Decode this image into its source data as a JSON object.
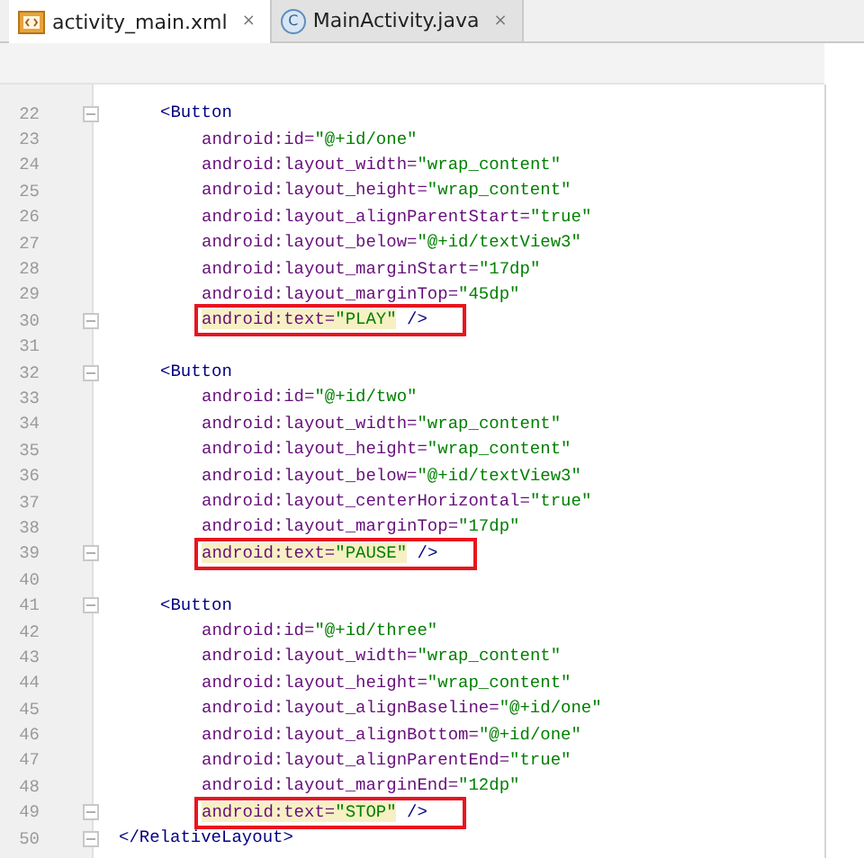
{
  "tabs": [
    {
      "label": "activity_main.xml",
      "kind": "xml",
      "selected": true,
      "close": "×"
    },
    {
      "label": "MainActivity.java",
      "kind": "class",
      "selected": false,
      "close": "×",
      "icon_text": "C"
    }
  ],
  "editor": {
    "lines": [
      {
        "number": "22",
        "fold": true,
        "highlighted": false,
        "tokens": [
          {
            "kind": "tag",
            "t": "<Button"
          }
        ]
      },
      {
        "number": "23",
        "fold": false,
        "highlighted": false,
        "tokens": [
          {
            "kind": "attr",
            "t": "android:id="
          },
          {
            "kind": "value",
            "t": "\"@+id/one\""
          }
        ]
      },
      {
        "number": "24",
        "fold": false,
        "highlighted": false,
        "tokens": [
          {
            "kind": "attr",
            "t": "android:layout_width="
          },
          {
            "kind": "value",
            "t": "\"wrap_content\""
          }
        ]
      },
      {
        "number": "25",
        "fold": false,
        "highlighted": false,
        "tokens": [
          {
            "kind": "attr",
            "t": "android:layout_height="
          },
          {
            "kind": "value",
            "t": "\"wrap_content\""
          }
        ]
      },
      {
        "number": "26",
        "fold": false,
        "highlighted": false,
        "tokens": [
          {
            "kind": "attr",
            "t": "android:layout_alignParentStart="
          },
          {
            "kind": "value",
            "t": "\"true\""
          }
        ]
      },
      {
        "number": "27",
        "fold": false,
        "highlighted": false,
        "tokens": [
          {
            "kind": "attr",
            "t": "android:layout_below="
          },
          {
            "kind": "value",
            "t": "\"@+id/textView3\""
          }
        ]
      },
      {
        "number": "28",
        "fold": false,
        "highlighted": false,
        "tokens": [
          {
            "kind": "attr",
            "t": "android:layout_marginStart="
          },
          {
            "kind": "value",
            "t": "\"17dp\""
          }
        ]
      },
      {
        "number": "29",
        "fold": false,
        "highlighted": false,
        "tokens": [
          {
            "kind": "attr",
            "t": "android:layout_marginTop="
          },
          {
            "kind": "value",
            "t": "\"45dp\""
          }
        ]
      },
      {
        "number": "30",
        "fold": true,
        "highlighted": true,
        "tokens": [
          {
            "kind": "attr",
            "t": "android:text="
          },
          {
            "kind": "value",
            "t": "\"PLAY\""
          },
          {
            "kind": "punct",
            "t": " />"
          }
        ]
      },
      {
        "number": "31",
        "fold": false,
        "highlighted": false
      },
      {
        "number": "32",
        "fold": true,
        "highlighted": false,
        "tokens": [
          {
            "kind": "tag",
            "t": "<Button"
          }
        ]
      },
      {
        "number": "33",
        "fold": false,
        "highlighted": false,
        "tokens": [
          {
            "kind": "attr",
            "t": "android:id="
          },
          {
            "kind": "value",
            "t": "\"@+id/two\""
          }
        ]
      },
      {
        "number": "34",
        "fold": false,
        "highlighted": false,
        "tokens": [
          {
            "kind": "attr",
            "t": "android:layout_width="
          },
          {
            "kind": "value",
            "t": "\"wrap_content\""
          }
        ]
      },
      {
        "number": "35",
        "fold": false,
        "highlighted": false,
        "tokens": [
          {
            "kind": "attr",
            "t": "android:layout_height="
          },
          {
            "kind": "value",
            "t": "\"wrap_content\""
          }
        ]
      },
      {
        "number": "36",
        "fold": false,
        "highlighted": false,
        "tokens": [
          {
            "kind": "attr",
            "t": "android:layout_below="
          },
          {
            "kind": "value",
            "t": "\"@+id/textView3\""
          }
        ]
      },
      {
        "number": "37",
        "fold": false,
        "highlighted": false,
        "tokens": [
          {
            "kind": "attr",
            "t": "android:layout_centerHorizontal="
          },
          {
            "kind": "value",
            "t": "\"true\""
          }
        ]
      },
      {
        "number": "38",
        "fold": false,
        "highlighted": false,
        "tokens": [
          {
            "kind": "attr",
            "t": "android:layout_marginTop="
          },
          {
            "kind": "value",
            "t": "\"17dp\""
          }
        ]
      },
      {
        "number": "39",
        "fold": true,
        "highlighted": true,
        "tokens": [
          {
            "kind": "attr",
            "t": "android:text="
          },
          {
            "kind": "value",
            "t": "\"PAUSE\""
          },
          {
            "kind": "punct",
            "t": " />"
          }
        ]
      },
      {
        "number": "40",
        "fold": false,
        "highlighted": false
      },
      {
        "number": "41",
        "fold": true,
        "highlighted": false,
        "tokens": [
          {
            "kind": "tag",
            "t": "<Button"
          }
        ]
      },
      {
        "number": "42",
        "fold": false,
        "highlighted": false,
        "tokens": [
          {
            "kind": "attr",
            "t": "android:id="
          },
          {
            "kind": "value",
            "t": "\"@+id/three\""
          }
        ]
      },
      {
        "number": "43",
        "fold": false,
        "highlighted": false,
        "tokens": [
          {
            "kind": "attr",
            "t": "android:layout_width="
          },
          {
            "kind": "value",
            "t": "\"wrap_content\""
          }
        ]
      },
      {
        "number": "44",
        "fold": false,
        "highlighted": false,
        "tokens": [
          {
            "kind": "attr",
            "t": "android:layout_height="
          },
          {
            "kind": "value",
            "t": "\"wrap_content\""
          }
        ]
      },
      {
        "number": "45",
        "fold": false,
        "highlighted": false,
        "tokens": [
          {
            "kind": "attr",
            "t": "android:layout_alignBaseline="
          },
          {
            "kind": "value",
            "t": "\"@+id/one\""
          }
        ]
      },
      {
        "number": "46",
        "fold": false,
        "highlighted": false,
        "tokens": [
          {
            "kind": "attr",
            "t": "android:layout_alignBottom="
          },
          {
            "kind": "value",
            "t": "\"@+id/one\""
          }
        ]
      },
      {
        "number": "47",
        "fold": false,
        "highlighted": false,
        "tokens": [
          {
            "kind": "attr",
            "t": "android:layout_alignParentEnd="
          },
          {
            "kind": "value",
            "t": "\"true\""
          }
        ]
      },
      {
        "number": "48",
        "fold": false,
        "highlighted": false,
        "tokens": [
          {
            "kind": "attr",
            "t": "android:layout_marginEnd="
          },
          {
            "kind": "value",
            "t": "\"12dp\""
          }
        ]
      },
      {
        "number": "49",
        "fold": true,
        "highlighted": true,
        "tokens": [
          {
            "kind": "attr",
            "t": "android:text="
          },
          {
            "kind": "value",
            "t": "\"STOP\""
          },
          {
            "kind": "punct",
            "t": " />"
          }
        ]
      },
      {
        "number": "50",
        "fold": true,
        "highlighted": false,
        "tokens": [
          {
            "kind": "closetag",
            "t": "</RelativeLayout>"
          }
        ]
      }
    ]
  }
}
